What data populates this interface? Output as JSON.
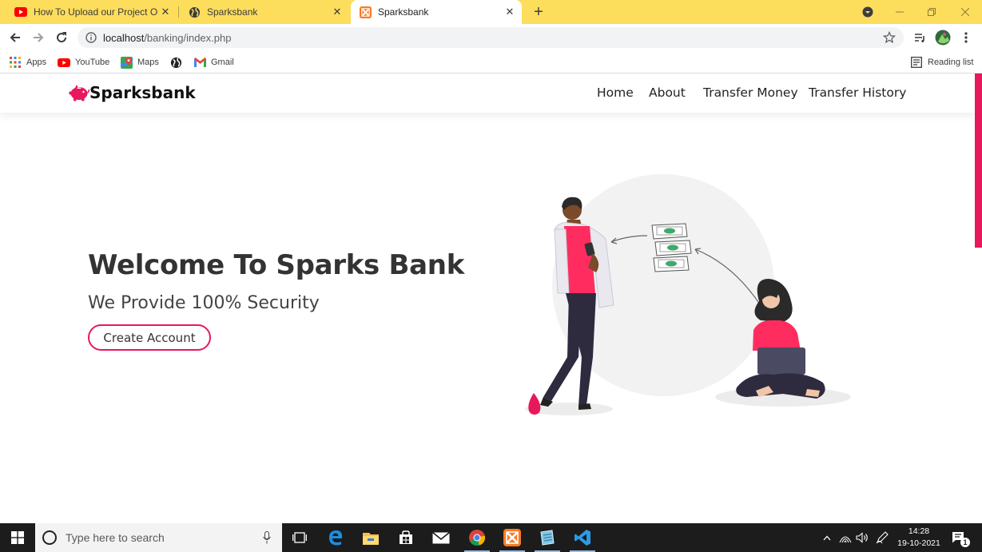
{
  "browser": {
    "tabs": [
      {
        "title": "How To Upload our Project Onlin",
        "close": "✕",
        "favicon": "youtube-icon"
      },
      {
        "title": "Sparksbank",
        "close": "✕",
        "favicon": "globe-icon"
      },
      {
        "title": "Sparksbank",
        "close": "✕",
        "favicon": "xampp-icon",
        "active": true
      }
    ],
    "new_tab": "+",
    "address": {
      "host": "localhost",
      "path": "/banking/index.php"
    },
    "bookmarks": [
      {
        "label": "Apps",
        "icon": "apps-grid-icon"
      },
      {
        "label": "YouTube",
        "icon": "youtube-icon"
      },
      {
        "label": "Maps",
        "icon": "maps-icon"
      },
      {
        "label": "",
        "icon": "globe-icon"
      },
      {
        "label": "Gmail",
        "icon": "gmail-icon"
      }
    ],
    "reading_list": "Reading list"
  },
  "site": {
    "brand": "Sparksbank",
    "nav": [
      "Home",
      "About",
      "Transfer Money",
      "Transfer History"
    ],
    "hero": {
      "title": "Welcome To Sparks Bank",
      "subtitle": "We Provide 100% Security",
      "cta": "Create Account"
    },
    "accent_color": "#e8185c"
  },
  "taskbar": {
    "search_placeholder": "Type here to search",
    "time": "14:28",
    "date": "19-10-2021",
    "notification_count": "1"
  }
}
